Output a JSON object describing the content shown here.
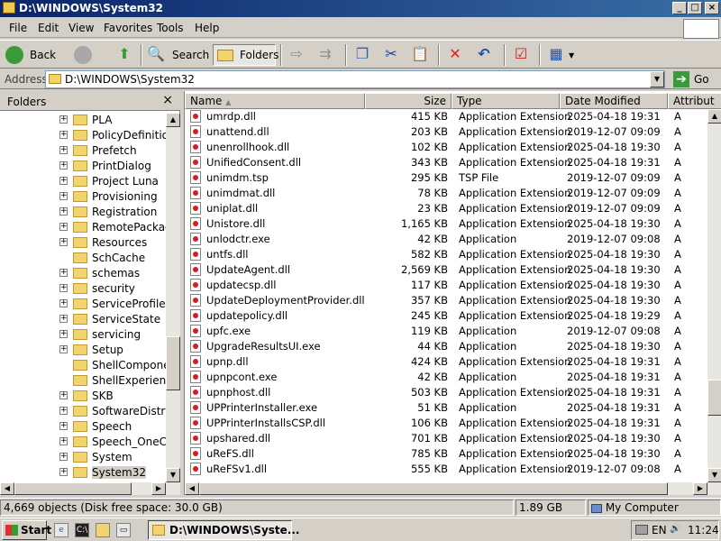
{
  "window": {
    "title": "D:\\WINDOWS\\System32",
    "controls": {
      "minimize": "_",
      "maximize": "□",
      "close": "×"
    }
  },
  "menu": [
    "File",
    "Edit",
    "View",
    "Favorites",
    "Tools",
    "Help"
  ],
  "toolbar": {
    "back_label": "Back",
    "search_label": "Search",
    "folders_label": "Folders"
  },
  "address": {
    "label": "Address",
    "value": "D:\\WINDOWS\\System32",
    "go_label": "Go"
  },
  "folders_pane": {
    "title": "Folders",
    "close": "×",
    "items": [
      {
        "label": "PLA",
        "expandable": true
      },
      {
        "label": "PolicyDefinitions",
        "expandable": true
      },
      {
        "label": "Prefetch",
        "expandable": true
      },
      {
        "label": "PrintDialog",
        "expandable": true
      },
      {
        "label": "Project Luna",
        "expandable": true
      },
      {
        "label": "Provisioning",
        "expandable": true
      },
      {
        "label": "Registration",
        "expandable": true
      },
      {
        "label": "RemotePackage",
        "expandable": true
      },
      {
        "label": "Resources",
        "expandable": true
      },
      {
        "label": "SchCache",
        "expandable": false
      },
      {
        "label": "schemas",
        "expandable": true
      },
      {
        "label": "security",
        "expandable": true
      },
      {
        "label": "ServiceProfiles",
        "expandable": true
      },
      {
        "label": "ServiceState",
        "expandable": true
      },
      {
        "label": "servicing",
        "expandable": true
      },
      {
        "label": "Setup",
        "expandable": true
      },
      {
        "label": "ShellComponents",
        "expandable": false
      },
      {
        "label": "ShellExperiences",
        "expandable": false
      },
      {
        "label": "SKB",
        "expandable": true
      },
      {
        "label": "SoftwareDistribut",
        "expandable": true
      },
      {
        "label": "Speech",
        "expandable": true
      },
      {
        "label": "Speech_OneCor",
        "expandable": true
      },
      {
        "label": "System",
        "expandable": true
      },
      {
        "label": "System32",
        "expandable": true,
        "selected": true
      }
    ]
  },
  "columns": {
    "name": "Name",
    "size": "Size",
    "type": "Type",
    "date": "Date Modified",
    "attributes": "Attribut"
  },
  "files": [
    {
      "name": "umrdp.dll",
      "size": "415 KB",
      "type": "Application Extension",
      "date": "2025-04-18 19:31",
      "attr": "A"
    },
    {
      "name": "unattend.dll",
      "size": "203 KB",
      "type": "Application Extension",
      "date": "2019-12-07 09:09",
      "attr": "A"
    },
    {
      "name": "unenrollhook.dll",
      "size": "102 KB",
      "type": "Application Extension",
      "date": "2025-04-18 19:30",
      "attr": "A"
    },
    {
      "name": "UnifiedConsent.dll",
      "size": "343 KB",
      "type": "Application Extension",
      "date": "2025-04-18 19:31",
      "attr": "A"
    },
    {
      "name": "unimdm.tsp",
      "size": "295 KB",
      "type": "TSP File",
      "date": "2019-12-07 09:09",
      "attr": "A"
    },
    {
      "name": "unimdmat.dll",
      "size": "78 KB",
      "type": "Application Extension",
      "date": "2019-12-07 09:09",
      "attr": "A"
    },
    {
      "name": "uniplat.dll",
      "size": "23 KB",
      "type": "Application Extension",
      "date": "2019-12-07 09:09",
      "attr": "A"
    },
    {
      "name": "Unistore.dll",
      "size": "1,165 KB",
      "type": "Application Extension",
      "date": "2025-04-18 19:30",
      "attr": "A"
    },
    {
      "name": "unlodctr.exe",
      "size": "42 KB",
      "type": "Application",
      "date": "2019-12-07 09:08",
      "attr": "A"
    },
    {
      "name": "untfs.dll",
      "size": "582 KB",
      "type": "Application Extension",
      "date": "2025-04-18 19:30",
      "attr": "A"
    },
    {
      "name": "UpdateAgent.dll",
      "size": "2,569 KB",
      "type": "Application Extension",
      "date": "2025-04-18 19:30",
      "attr": "A"
    },
    {
      "name": "updatecsp.dll",
      "size": "117 KB",
      "type": "Application Extension",
      "date": "2025-04-18 19:30",
      "attr": "A"
    },
    {
      "name": "UpdateDeploymentProvider.dll",
      "size": "357 KB",
      "type": "Application Extension",
      "date": "2025-04-18 19:30",
      "attr": "A"
    },
    {
      "name": "updatepolicy.dll",
      "size": "245 KB",
      "type": "Application Extension",
      "date": "2025-04-18 19:29",
      "attr": "A"
    },
    {
      "name": "upfc.exe",
      "size": "119 KB",
      "type": "Application",
      "date": "2019-12-07 09:08",
      "attr": "A"
    },
    {
      "name": "UpgradeResultsUI.exe",
      "size": "44 KB",
      "type": "Application",
      "date": "2025-04-18 19:30",
      "attr": "A"
    },
    {
      "name": "upnp.dll",
      "size": "424 KB",
      "type": "Application Extension",
      "date": "2025-04-18 19:31",
      "attr": "A"
    },
    {
      "name": "upnpcont.exe",
      "size": "42 KB",
      "type": "Application",
      "date": "2025-04-18 19:31",
      "attr": "A"
    },
    {
      "name": "upnphost.dll",
      "size": "503 KB",
      "type": "Application Extension",
      "date": "2025-04-18 19:31",
      "attr": "A"
    },
    {
      "name": "UPPrinterInstaller.exe",
      "size": "51 KB",
      "type": "Application",
      "date": "2025-04-18 19:31",
      "attr": "A"
    },
    {
      "name": "UPPrinterInstallsCSP.dll",
      "size": "106 KB",
      "type": "Application Extension",
      "date": "2025-04-18 19:31",
      "attr": "A"
    },
    {
      "name": "upshared.dll",
      "size": "701 KB",
      "type": "Application Extension",
      "date": "2025-04-18 19:30",
      "attr": "A"
    },
    {
      "name": "uReFS.dll",
      "size": "785 KB",
      "type": "Application Extension",
      "date": "2025-04-18 19:30",
      "attr": "A"
    },
    {
      "name": "uReFSv1.dll",
      "size": "555 KB",
      "type": "Application Extension",
      "date": "2019-12-07 09:08",
      "attr": "A"
    }
  ],
  "status": {
    "objects": "4,669 objects (Disk free space: 30.0 GB)",
    "size": "1.89 GB",
    "zone": "My Computer"
  },
  "taskbar": {
    "start_label": "Start",
    "task_label": "D:\\WINDOWS\\Syste...",
    "lang": "EN",
    "time": "11:24"
  }
}
